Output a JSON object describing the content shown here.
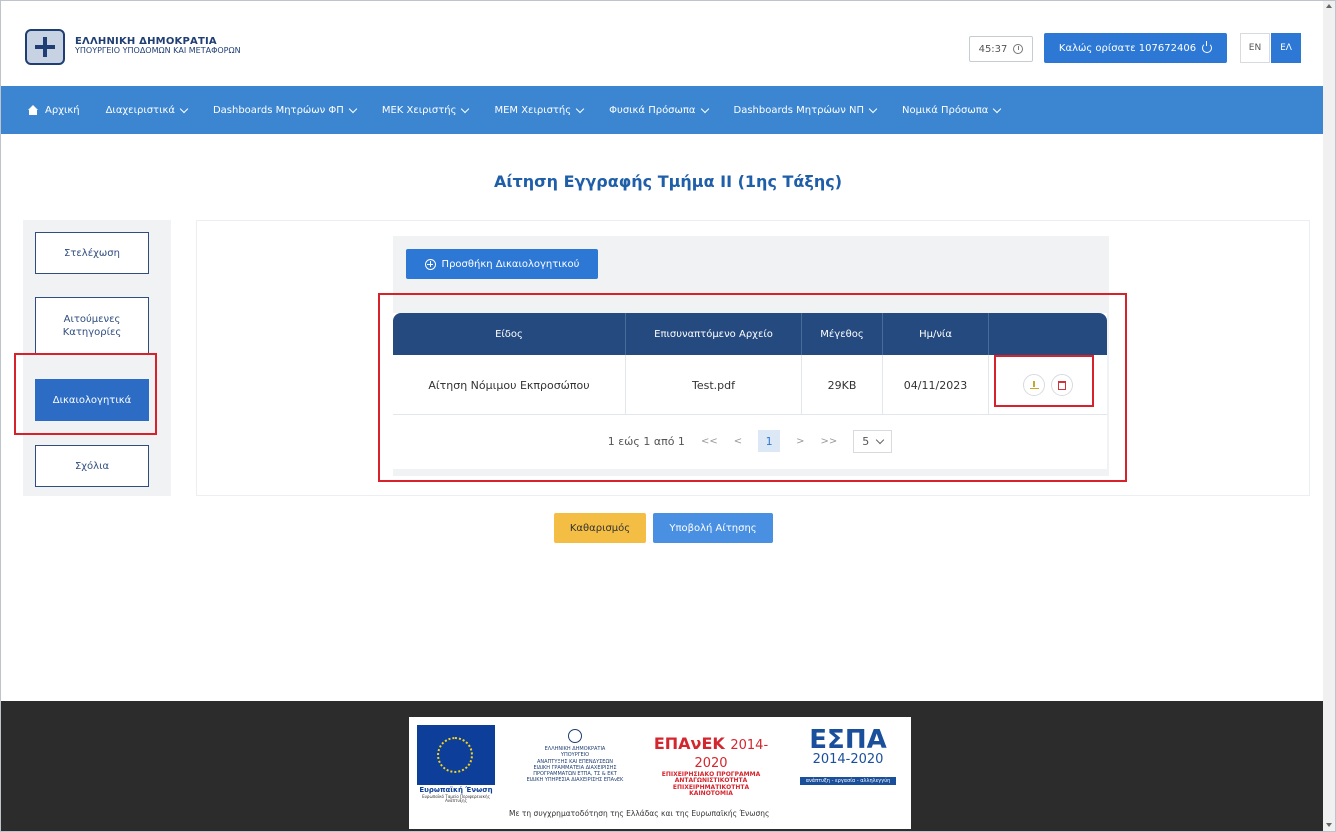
{
  "header": {
    "brand_title": "ΕΛΛΗΝΙΚΗ ΔΗΜΟΚΡΑΤΙΑ",
    "brand_subtitle": "ΥΠΟΥΡΓΕΙΟ ΥΠΟΔΟΜΩΝ ΚΑΙ ΜΕΤΑΦΟΡΩΝ",
    "timer": "45:37",
    "welcome": "Καλώς ορίσατε 107672406",
    "lang_en": "EN",
    "lang_el": "ΕΛ"
  },
  "nav": {
    "items": [
      "Αρχική",
      "Διαχειριστικά",
      "Dashboards Μητρώων ΦΠ",
      "ΜΕΚ Χειριστής",
      "ΜΕΜ Χειριστής",
      "Φυσικά Πρόσωπα",
      "Dashboards Μητρώων ΝΠ",
      "Νομικά Πρόσωπα"
    ]
  },
  "page": {
    "title": "Αίτηση Εγγραφής Τμήμα ΙΙ (1ης Τάξης)"
  },
  "sidebar": {
    "items": [
      {
        "label": "Στελέχωση"
      },
      {
        "label": "Αιτούμενες Κατηγορίες"
      },
      {
        "label": "Δικαιολογητικά",
        "active": true
      },
      {
        "label": "Σχόλια"
      }
    ]
  },
  "main": {
    "add_button": "Προσθήκη Δικαιολογητικού",
    "table": {
      "columns": [
        "Είδος",
        "Επισυναπτόμενο Αρχείο",
        "Μέγεθος",
        "Ημ/νία",
        ""
      ],
      "rows": [
        [
          "Αίτηση Νόμιμου Εκπροσώπου",
          "Test.pdf",
          "29KB",
          "04/11/2023"
        ]
      ]
    },
    "pager": {
      "summary": "1 εώς 1 από 1",
      "first": "<<",
      "prev": "<",
      "current": "1",
      "next": ">",
      "last": ">>",
      "page_size": "5"
    }
  },
  "actions": {
    "clear": "Καθαρισμός",
    "submit": "Υποβολή Αίτησης"
  },
  "footer": {
    "eu": "Ευρωπαϊκή Ένωση",
    "eu_sub": "Ευρωπαϊκό Ταμείο Περιφερειακής Ανάπτυξης",
    "ministry_lines": [
      "ΕΛΛΗΝΙΚΗ ΔΗΜΟΚΡΑΤΙΑ",
      "ΥΠΟΥΡΓΕΙΟ",
      "ΑΝΑΠΤΥΞΗΣ ΚΑΙ ΕΠΕΝΔΥΣΕΩΝ",
      "ΕΙΔΙΚΗ ΓΡΑΜΜΑΤΕΙΑ ΔΙΑΧΕΙΡΙΣΗΣ",
      "ΠΡΟΓΡΑΜΜΑΤΩΝ ΕΤΠΑ, ΤΣ & ΕΚΤ",
      "ΕΙΔΙΚΗ ΥΠΗΡΕΣΙΑ ΔΙΑΧΕΙΡΙΣΗΣ ΕΠΑνΕΚ"
    ],
    "epanek_title": "ΕΠΑνΕΚ",
    "epanek_years": "2014-2020",
    "epanek_lines": [
      "ΕΠΙΧΕΙΡΗΣΙΑΚΟ ΠΡΟΓΡΑΜΜΑ",
      "ΑΝΤΑΓΩΝΙΣΤΙΚΟΤΗΤΑ",
      "ΕΠΙΧΕΙΡΗΜΑΤΙΚΟΤΗΤΑ",
      "ΚΑΙΝΟΤΟΜΙΑ"
    ],
    "espa_title": "ΕΣΠΑ",
    "espa_years": "2014-2020",
    "espa_tagline": "ανάπτυξη - εργασία - αλληλεγγύη",
    "cofund": "Με τη συγχρηματοδότηση της Ελλάδας και της Ευρωπαϊκής Ένωσης"
  }
}
